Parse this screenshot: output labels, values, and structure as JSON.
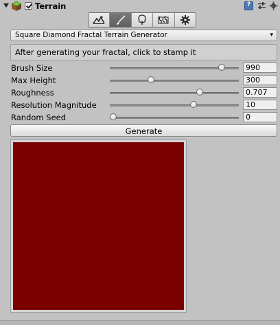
{
  "component": {
    "title": "Terrain",
    "enabled": true
  },
  "toolbar": {
    "tools": [
      {
        "icon": "raise-lower-terrain-icon",
        "active": false
      },
      {
        "icon": "paint-brush-icon",
        "active": true
      },
      {
        "icon": "place-trees-icon",
        "active": false
      },
      {
        "icon": "paint-details-icon",
        "active": false
      },
      {
        "icon": "terrain-settings-icon",
        "active": false
      }
    ]
  },
  "generator": {
    "selected": "Square Diamond Fractal Terrain Generator"
  },
  "help_text": "After generating your fractal, click to stamp it",
  "params": [
    {
      "label": "Brush Size",
      "value": "990",
      "fraction": 0.89
    },
    {
      "label": "Max Height",
      "value": "300",
      "fraction": 0.31
    },
    {
      "label": "Roughness",
      "value": "0.707",
      "fraction": 0.71
    },
    {
      "label": "Resolution Magnitude",
      "value": "10",
      "fraction": 0.66
    },
    {
      "label": "Random Seed",
      "value": "0",
      "fraction": 0.0
    }
  ],
  "generate_label": "Generate",
  "preview_color": "#7a0000"
}
